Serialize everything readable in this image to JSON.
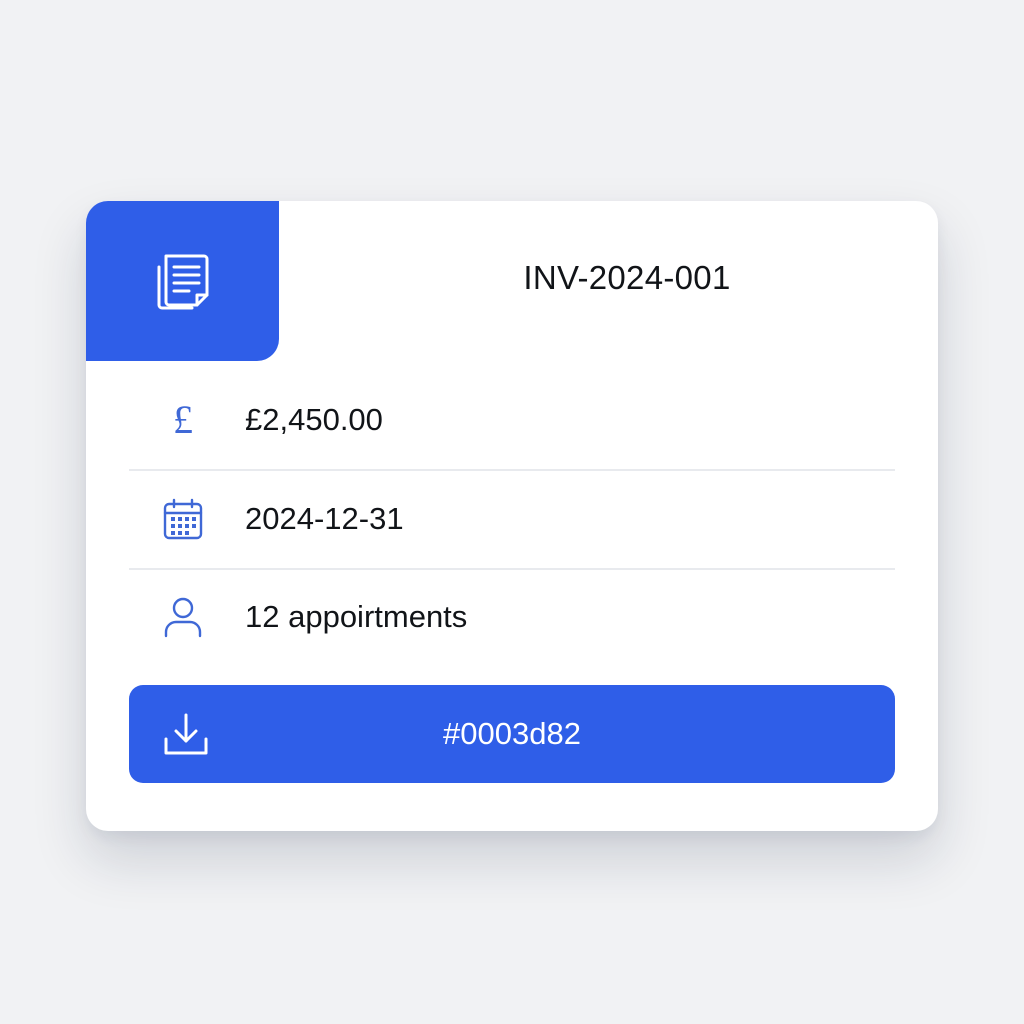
{
  "invoice": {
    "number": "INV-2024-001",
    "icon": "document-icon"
  },
  "details": [
    {
      "icon": "pound-icon",
      "glyph": "£",
      "text": "£2,450.00"
    },
    {
      "icon": "calendar-icon",
      "text": "2024-12-31"
    },
    {
      "icon": "user-icon",
      "text": "12 appoirtments"
    }
  ],
  "action": {
    "icon": "download-icon",
    "label": "#0003d82"
  },
  "colors": {
    "accent": "#2f5ee8",
    "icon": "#3f68d6",
    "background": "#f1f2f4",
    "card": "#ffffff"
  }
}
